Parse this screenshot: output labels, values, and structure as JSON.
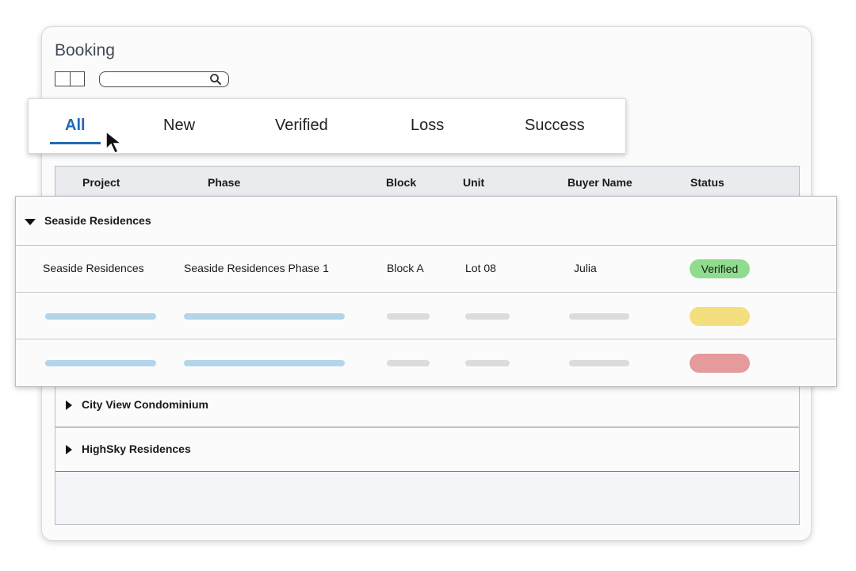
{
  "page": {
    "title": "Booking"
  },
  "search": {
    "placeholder": "",
    "value": ""
  },
  "tabs": [
    {
      "label": "All",
      "active": true
    },
    {
      "label": "New",
      "active": false
    },
    {
      "label": "Verified",
      "active": false
    },
    {
      "label": "Loss",
      "active": false
    },
    {
      "label": "Success",
      "active": false
    }
  ],
  "table": {
    "columns": [
      "Project",
      "Phase",
      "Block",
      "Unit",
      "Buyer Name",
      "Status"
    ],
    "groups": [
      {
        "name": "Seaside Residences",
        "expanded": true,
        "rows": [
          {
            "project": "Seaside Residences",
            "phase": "Seaside Residences Phase 1",
            "block": "Block A",
            "unit": "Lot 08",
            "buyer": "Julia",
            "status": "Verified"
          }
        ]
      },
      {
        "name": "City View Condominium",
        "expanded": false
      },
      {
        "name": "HighSky Residences",
        "expanded": false
      }
    ]
  },
  "colors": {
    "accent": "#1f6ab3",
    "status_verified": "#90dc8f",
    "status_pending": "#f4df7f",
    "status_loss": "#e59a9b",
    "placeholder_blue": "#b3d5ea",
    "placeholder_grey": "#dcdcde"
  },
  "icons": {
    "search": "search-icon",
    "cursor": "mouse-pointer-icon",
    "expanded": "caret-down-icon",
    "collapsed": "caret-right-icon"
  }
}
